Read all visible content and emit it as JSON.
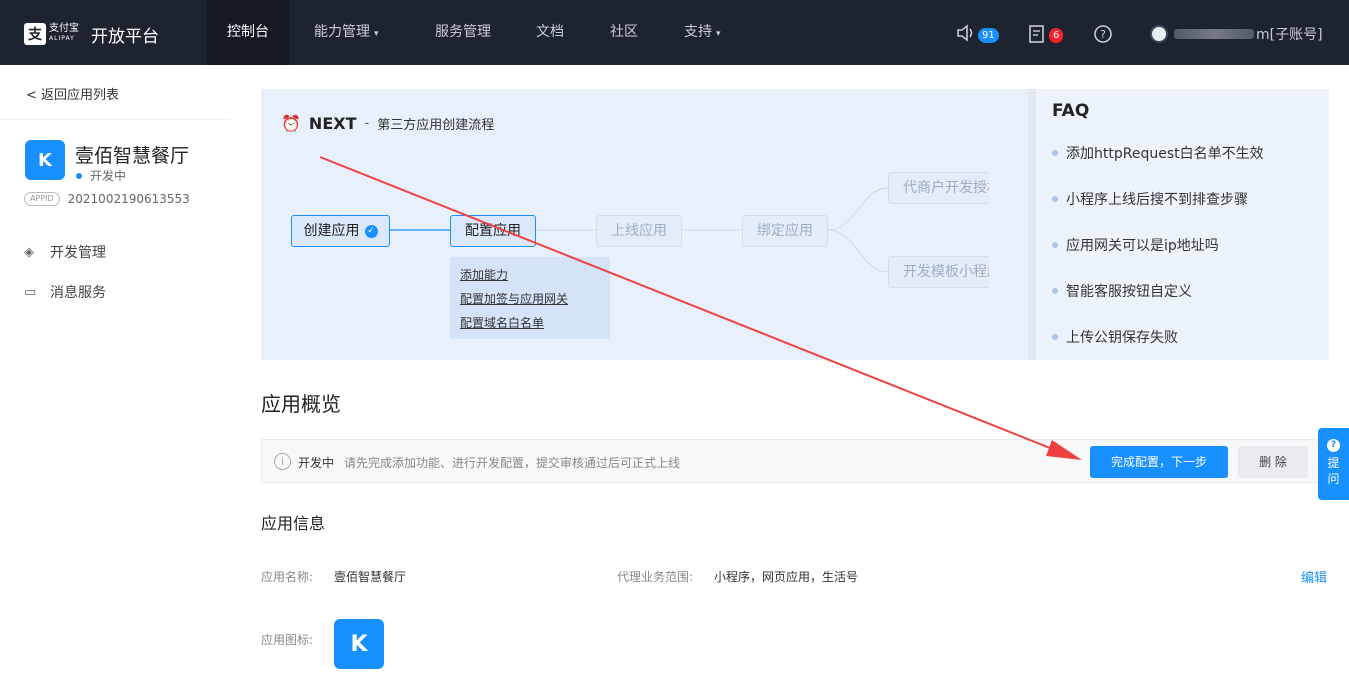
{
  "topnav": {
    "logo_text": "支付宝",
    "logo_sub": "ALIPAY",
    "platform": "开放平台",
    "items": [
      {
        "label": "控制台",
        "active": true
      },
      {
        "label": "能力管理",
        "caret": "▾"
      },
      {
        "label": "服务管理"
      },
      {
        "label": "文档"
      },
      {
        "label": "社区"
      },
      {
        "label": "支持",
        "caret": "▾"
      }
    ],
    "notify_count": "91",
    "task_count": "6",
    "account_suffix": "m[子账号]"
  },
  "sidebar": {
    "back_label": "< 返回应用列表",
    "app_name": "壹佰智慧餐厅",
    "app_status": "开发中",
    "appid_tag": "APPID",
    "appid": "2021002190613553",
    "menu": [
      {
        "label": "开发管理",
        "icon": "layers-icon"
      },
      {
        "label": "消息服务",
        "icon": "monitor-icon"
      }
    ]
  },
  "banner": {
    "next_title": "NEXT",
    "separator": "-",
    "subtitle": "第三方应用创建流程",
    "steps": {
      "create": "创建应用",
      "config": "配置应用",
      "online": "上线应用",
      "bind": "绑定应用",
      "merchant": "代商户开发授权",
      "template": "开发模板小程序"
    },
    "sublinks": [
      "添加能力",
      "配置加签与应用网关",
      "配置域名白名单"
    ]
  },
  "faq": {
    "title": "FAQ",
    "items": [
      "添加httpRequest白名单不生效",
      "小程序上线后搜不到排查步骤",
      "应用网关可以是ip地址吗",
      "智能客服按钮自定义",
      "上传公钥保存失败"
    ]
  },
  "overview": {
    "title": "应用概览",
    "status": "开发中",
    "tip": "请先完成添加功能、进行开发配置，提交审核通过后可正式上线",
    "primary_button": "完成配置，下一步",
    "delete_button": "删 除"
  },
  "info": {
    "title": "应用信息",
    "name_label": "应用名称:",
    "name_value": "壹佰智慧餐厅",
    "scope_label": "代理业务范围:",
    "scope_value": "小程序，网页应用，生活号",
    "edit_label": "编辑",
    "icon_label": "应用图标:"
  },
  "help": {
    "label": "提问"
  },
  "colors": {
    "accent": "#1890ff",
    "nav_bg": "#1e2330",
    "badge_blue": "#1890ff",
    "badge_red": "#f5222d",
    "arrow": "#f04040"
  }
}
